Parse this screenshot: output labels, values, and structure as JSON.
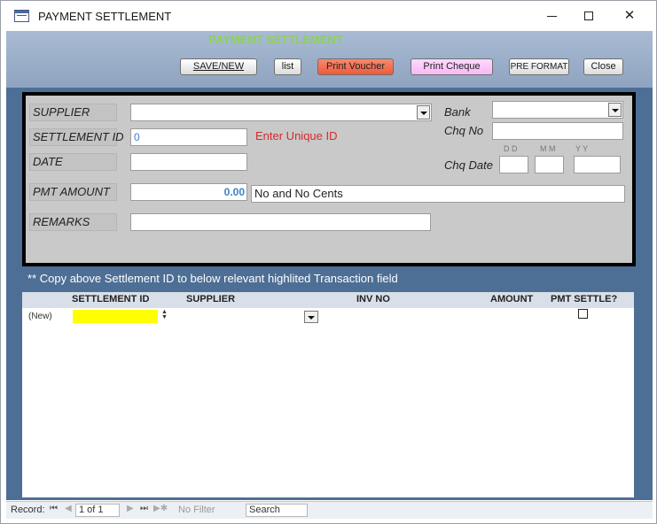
{
  "window": {
    "title": "PAYMENT SETTLEMENT",
    "minimize_glyph": "",
    "close_glyph": "✕"
  },
  "header": {
    "form_title": "PAYMENT SETTLEMENT",
    "title_color": "#8fd05a"
  },
  "toolbar": {
    "save_new": "SAVE/NEW",
    "list": "list",
    "print_voucher": "Print Voucher",
    "print_cheque": "Print Cheque",
    "pre_format": "PRE FORMAT",
    "close": "Close"
  },
  "form": {
    "supplier_label": "SUPPLIER",
    "supplier_value": "",
    "settlement_id_label": "SETTLEMENT ID",
    "settlement_id_value": "0",
    "enter_unique_id": "Enter Unique ID",
    "date_label": "DATE",
    "date_value": "",
    "pmt_amount_label": "PMT AMOUNT",
    "pmt_amount_value": "0.00",
    "amount_words": "No  and No Cents",
    "remarks_label": "REMARKS",
    "remarks_value": "",
    "bank_label": "Bank",
    "bank_value": "",
    "chq_no_label": "Chq No",
    "chq_no_value": "",
    "chq_date_label": "Chq Date",
    "dd_label": "D D",
    "mm_label": "M M",
    "yy_label": "Y Y"
  },
  "copy_note": "** Copy above Settlement ID to below relevant highlited Transaction field",
  "grid": {
    "columns": [
      "SETTLEMENT ID",
      "SUPPLIER",
      "INV NO",
      "AMOUNT",
      "PMT SETTLE?"
    ],
    "new_row_label": "(New)"
  },
  "navbar": {
    "record_label": "Record:",
    "first": "⏮",
    "prev": "◀",
    "record_value": "1 of 1",
    "next": "▶",
    "last": "⏭",
    "new": "▶✱",
    "no_filter": "No Filter",
    "search": "Search"
  },
  "colors": {
    "header_gradient_top": "#a9bbd3",
    "body_background": "#4e6f95",
    "panel_background": "#c9c9c9",
    "voucher_button": "#ef5a3c",
    "cheque_button": "#f7b8f5",
    "highlight_cell": "#ffff00",
    "hint_red": "#d9282a"
  }
}
